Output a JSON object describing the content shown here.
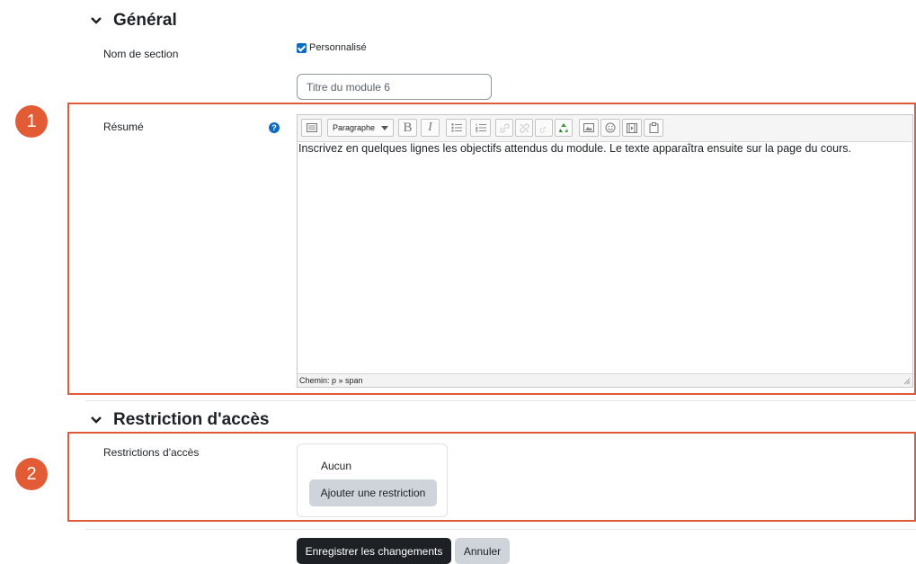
{
  "general": {
    "title": "Général",
    "section_name_label": "Nom de section",
    "custom_checkbox_label": "Personnalisé",
    "section_name_value": "Titre du module 6",
    "summary_label": "Résumé",
    "help_symbol": "?"
  },
  "editor": {
    "format_select": "Paragraphe",
    "content": "Inscrivez en quelques lignes les objectifs attendus du module. Le texte apparaîtra ensuite sur la page du cours.",
    "path": "Chemin: p » span"
  },
  "access": {
    "title": "Restriction d'accès",
    "label": "Restrictions d'accès",
    "none_text": "Aucun",
    "add_button": "Ajouter une restriction"
  },
  "footer": {
    "save_button": "Enregistrer les changements",
    "cancel_button": "Annuler"
  },
  "callouts": [
    {
      "number": "1"
    },
    {
      "number": "2"
    }
  ],
  "colors": {
    "callout": "#e05a3a",
    "primary": "#1d2125",
    "accent": "#0f6cbf"
  }
}
